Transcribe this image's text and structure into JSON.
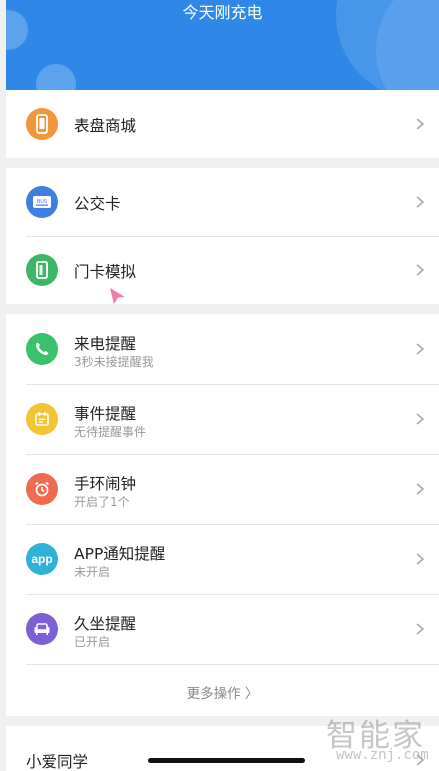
{
  "header": {
    "title": "今天刚充电",
    "color": "#2f88e8"
  },
  "sections": {
    "watch_face": {
      "label": "表盘商城",
      "icon": "watch-icon",
      "icon_color": "#f2963b"
    },
    "cards": [
      {
        "label": "公交卡",
        "icon": "bus-card-icon",
        "icon_color": "#3f7fe0"
      },
      {
        "label": "门卡模拟",
        "icon": "door-card-icon",
        "icon_color": "#3fb667"
      }
    ],
    "reminders": [
      {
        "label": "来电提醒",
        "sub": "3秒未接提醒我",
        "icon": "phone-icon",
        "icon_color": "#38c26b"
      },
      {
        "label": "事件提醒",
        "sub": "无待提醒事件",
        "icon": "calendar-icon",
        "icon_color": "#f3c532"
      },
      {
        "label": "手环闹钟",
        "sub": "开启了1个",
        "icon": "alarm-clock-icon",
        "icon_color": "#f06a4f"
      },
      {
        "label": "APP通知提醒",
        "sub": "未开启",
        "icon": "app-icon",
        "icon_color": "#2fb2d8",
        "icon_text": "app"
      },
      {
        "label": "久坐提醒",
        "sub": "已开启",
        "icon": "sofa-icon",
        "icon_color": "#7d5fd6"
      }
    ],
    "more_label": "更多操作 〉",
    "assistant_label": "小爱同学"
  },
  "watermark": {
    "top": "智能家",
    "bottom": "www.znj.com"
  }
}
